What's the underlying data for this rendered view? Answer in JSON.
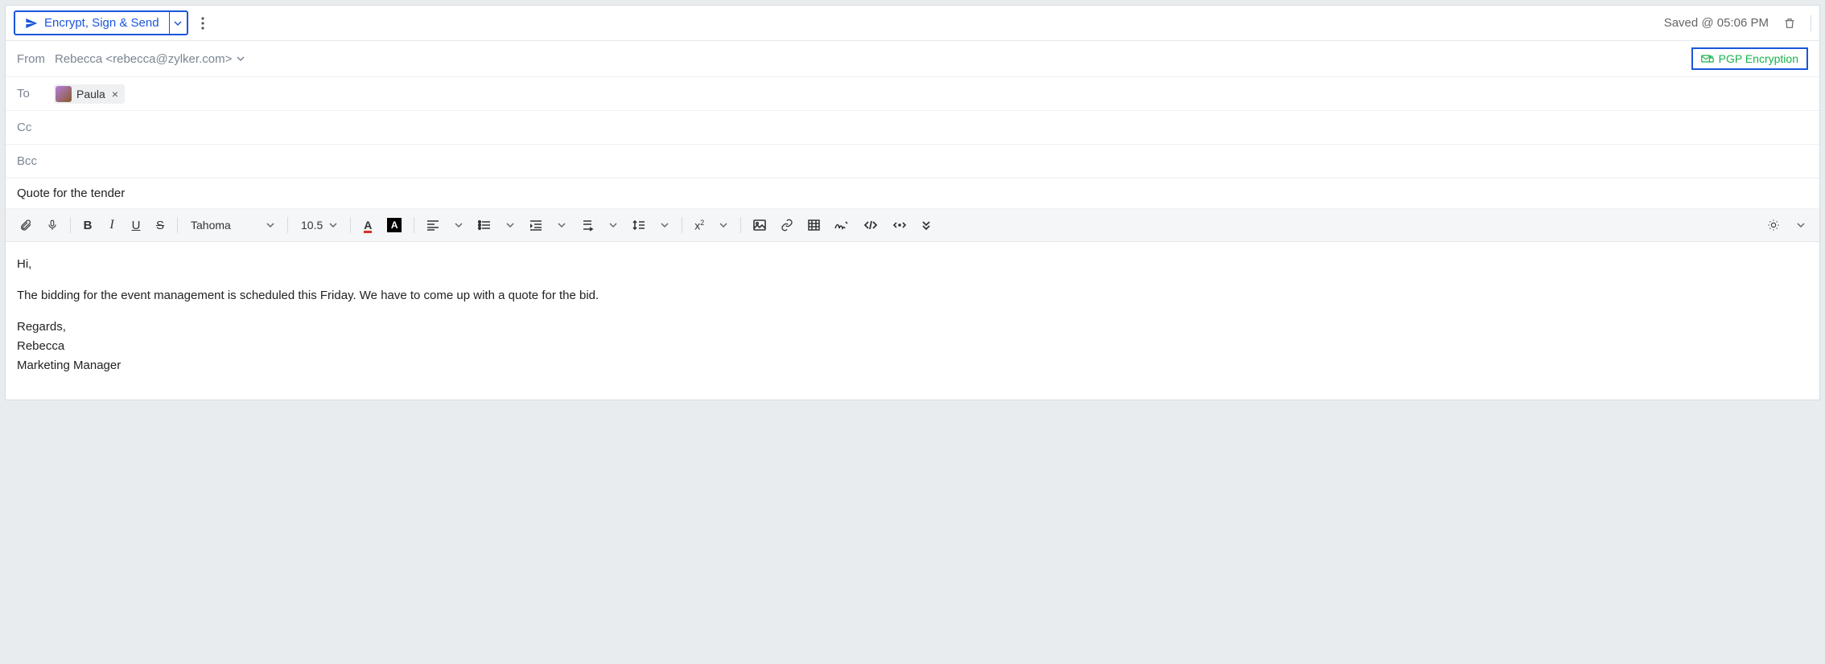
{
  "toolbar": {
    "send_label": "Encrypt, Sign & Send",
    "saved_status": "Saved @ 05:06 PM"
  },
  "fields": {
    "from_label": "From",
    "from_value": "Rebecca <rebecca@zylker.com>",
    "to_label": "To",
    "cc_label": "Cc",
    "bcc_label": "Bcc",
    "pgp_label": "PGP Encryption"
  },
  "recipients": {
    "to": [
      {
        "name": "Paula"
      }
    ]
  },
  "subject": "Quote for the tender",
  "format": {
    "font_family": "Tahoma",
    "font_size": "10.5"
  },
  "body": {
    "greeting": "Hi,",
    "para1": "The bidding for the event management is scheduled this Friday. We have to come up with a quote for the bid.",
    "signoff": "Regards,\nRebecca\nMarketing Manager"
  }
}
